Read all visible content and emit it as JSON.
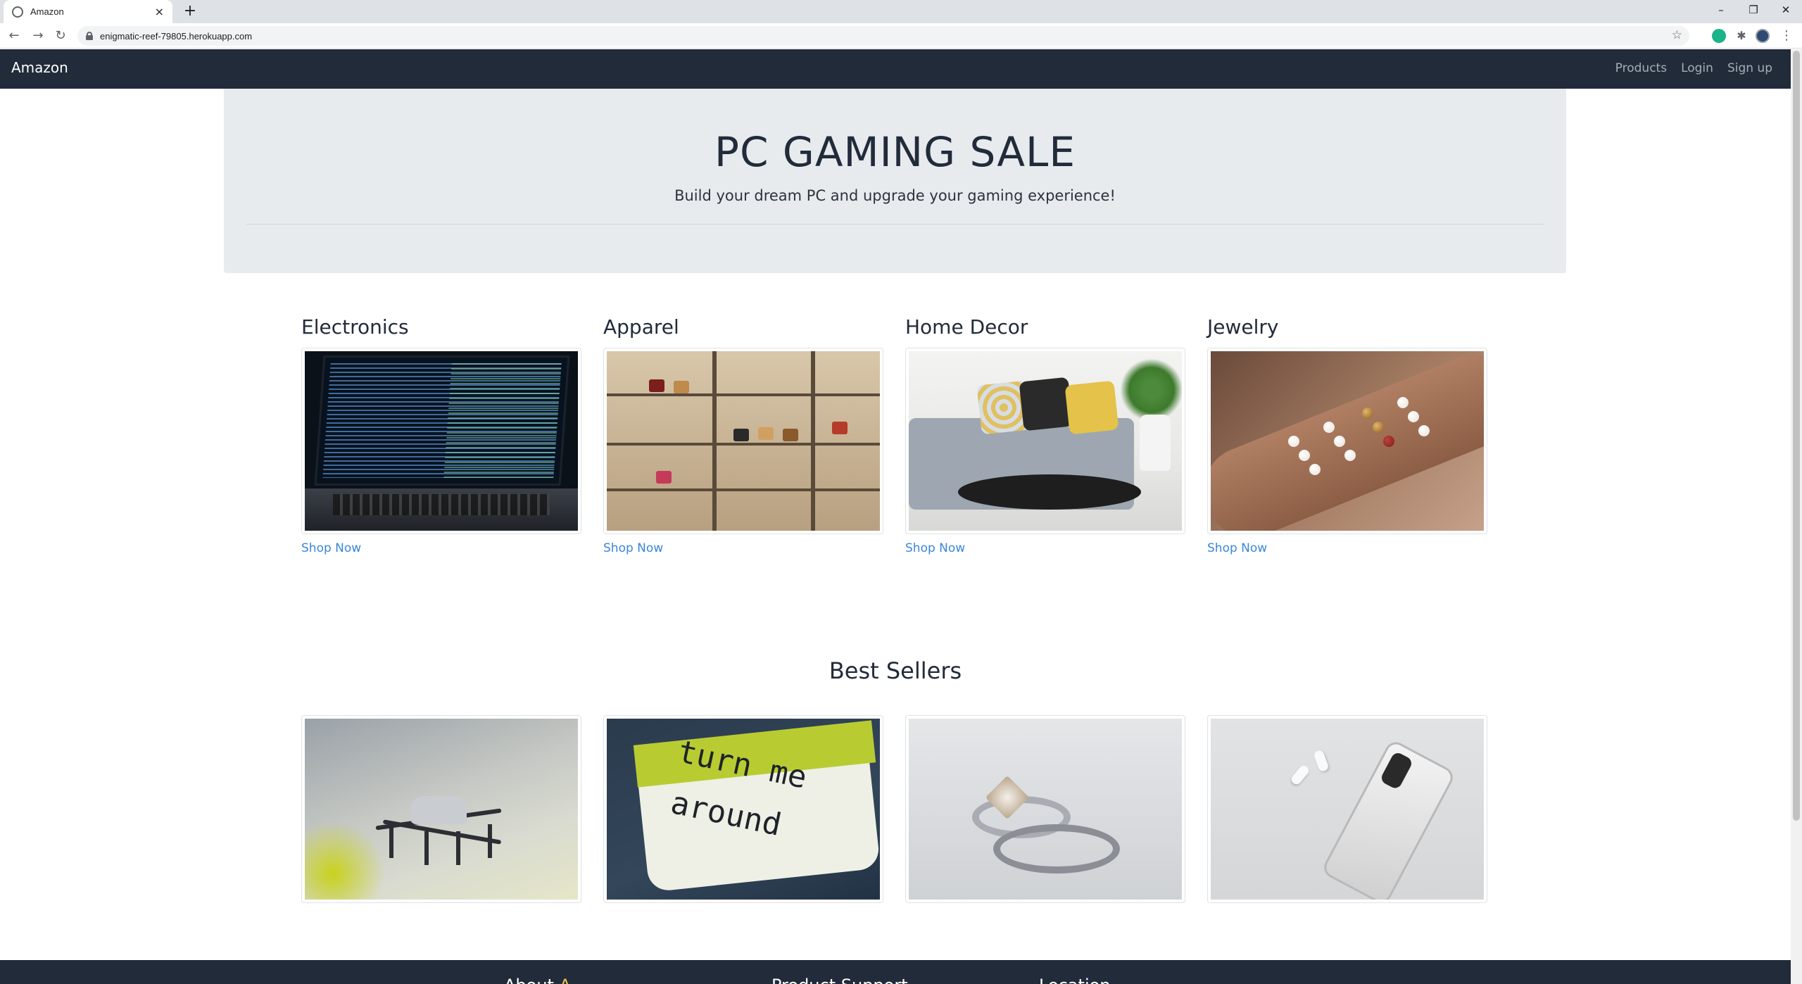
{
  "browser": {
    "tab_title": "Amazon",
    "url": "enigmatic-reef-79805.herokuapp.com",
    "new_tab": "+",
    "tab_close": "×",
    "min": "–",
    "max": "❐",
    "close": "✕"
  },
  "nav": {
    "brand": "Amazon",
    "links": [
      "Products",
      "Login",
      "Sign up"
    ]
  },
  "hero": {
    "title": "PC GAMING SALE",
    "subtitle": "Build your dream PC and upgrade your gaming experience!"
  },
  "categories": [
    {
      "name": "Electronics",
      "cta": "Shop Now"
    },
    {
      "name": "Apparel",
      "cta": "Shop Now"
    },
    {
      "name": "Home Decor",
      "cta": "Shop Now"
    },
    {
      "name": "Jewelry",
      "cta": "Shop Now"
    }
  ],
  "best_sellers": {
    "title": "Best Sellers"
  },
  "footer": {
    "col1_a": "About ",
    "col1_b": "A",
    "col2": "Product Support",
    "col3": "Location"
  },
  "colors": {
    "navbar": "#212b3a",
    "hero_bg": "#e8ebee",
    "link": "#3a87d9",
    "accent": "#f0c14b"
  }
}
